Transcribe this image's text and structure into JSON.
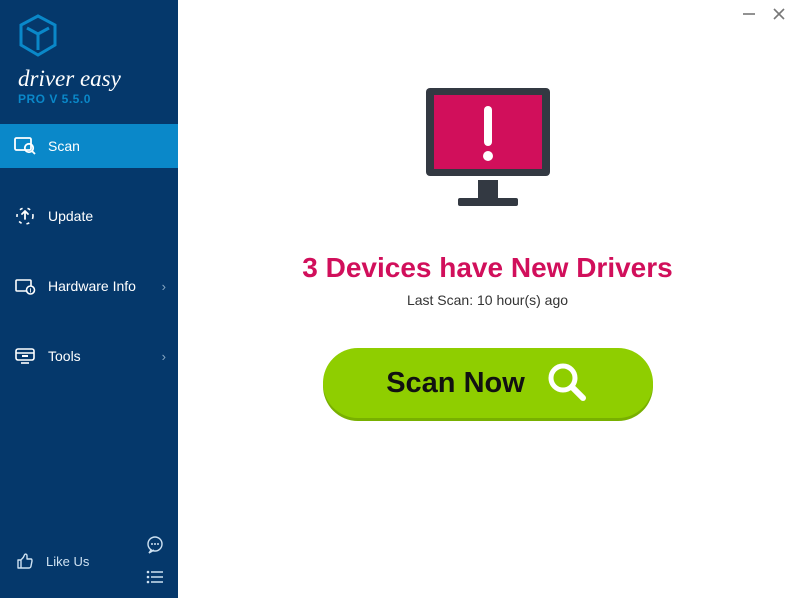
{
  "brand": {
    "name": "driver easy",
    "version_label": "PRO V 5.5.0"
  },
  "nav": {
    "scan": "Scan",
    "update": "Update",
    "hardware_info": "Hardware Info",
    "tools": "Tools"
  },
  "footer": {
    "like_us": "Like Us"
  },
  "main": {
    "headline": "3 Devices have New Drivers",
    "last_scan": "Last Scan: 10 hour(s) ago",
    "scan_button": "Scan Now"
  }
}
